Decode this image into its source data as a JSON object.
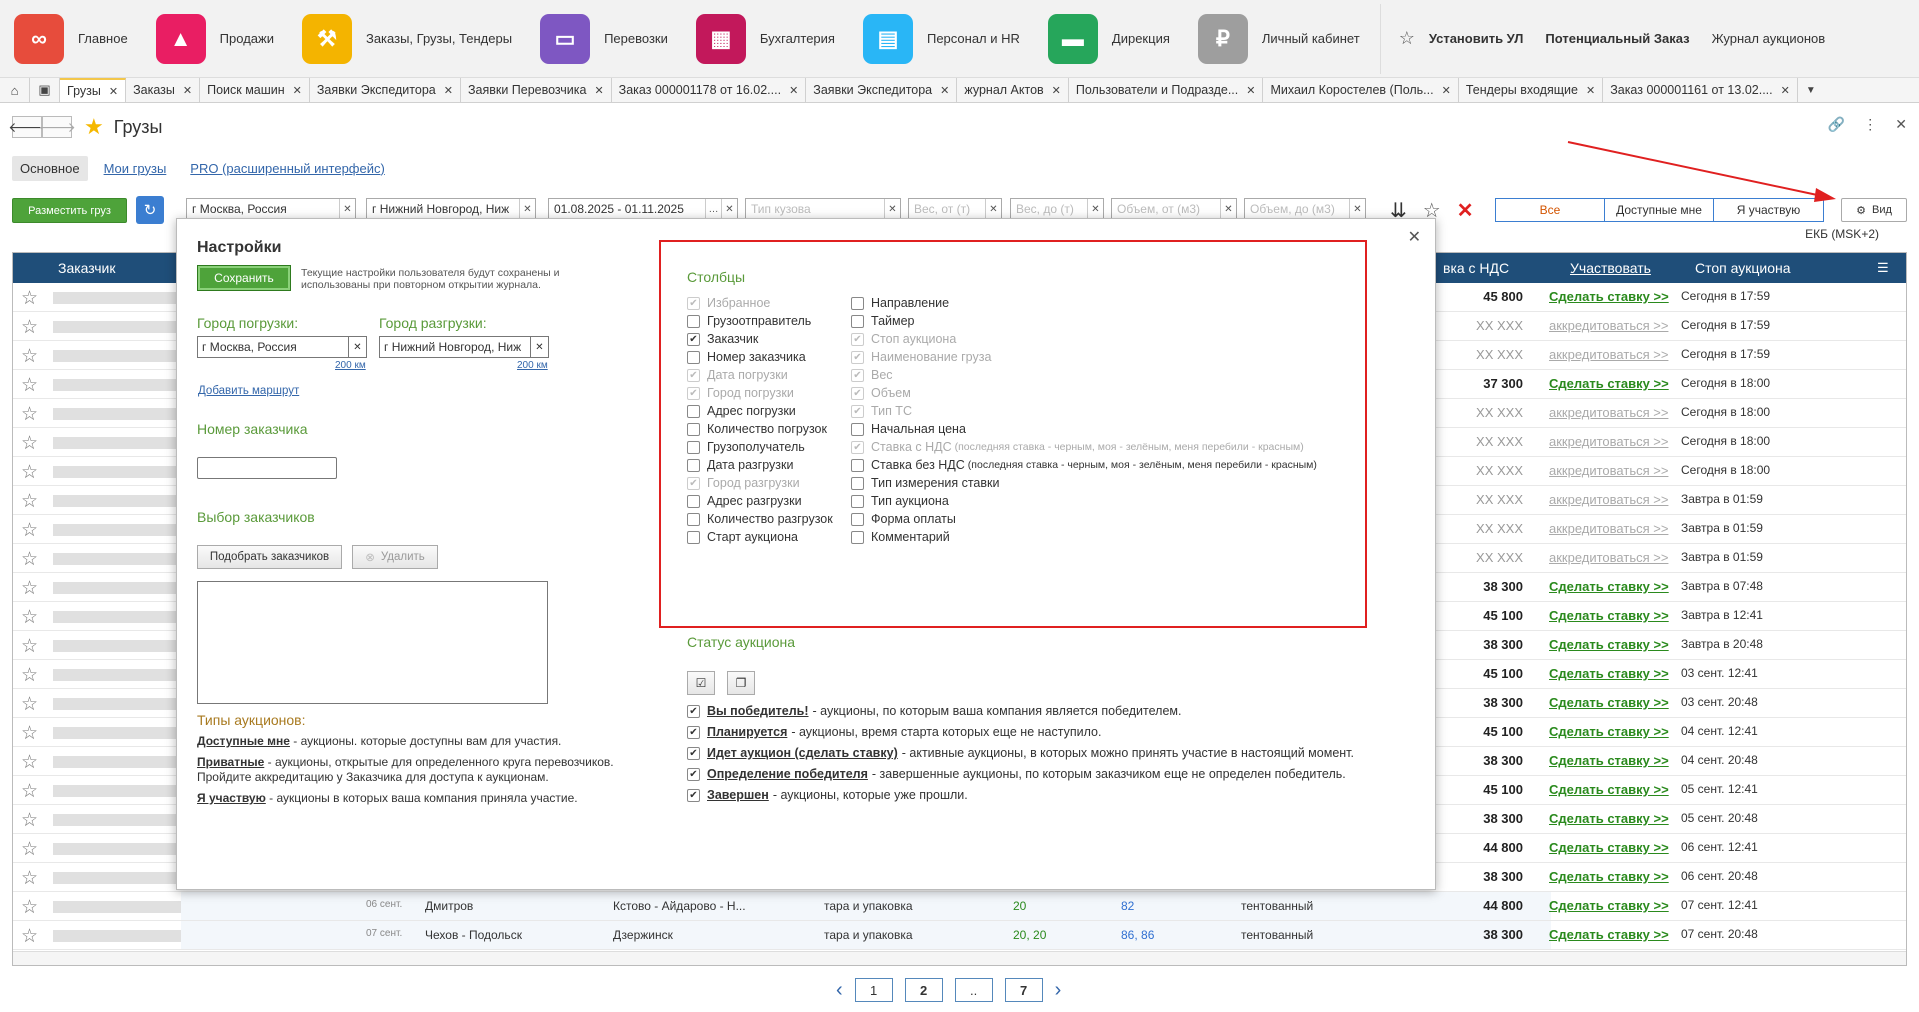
{
  "topnav": {
    "items": [
      {
        "label": "Главное",
        "icon": "logo-icon",
        "color": "#e74c3c"
      },
      {
        "label": "Продажи",
        "icon": "chart-up-icon",
        "color": "#e91e63"
      },
      {
        "label": "Заказы, Грузы, Тендеры",
        "icon": "gavel-icon",
        "color": "#f4b400"
      },
      {
        "label": "Перевозки",
        "icon": "truck-icon",
        "color": "#7e57c2"
      },
      {
        "label": "Бухгалтерия",
        "icon": "calculator-icon",
        "color": "#c2185b"
      },
      {
        "label": "Персонал и HR",
        "icon": "badge-icon",
        "color": "#29b6f6"
      },
      {
        "label": "Дирекция",
        "icon": "briefcase-icon",
        "color": "#26a65b"
      },
      {
        "label": "Личный кабинет",
        "icon": "lock-icon",
        "color": "#9e9e9e"
      }
    ],
    "links": [
      "Установить УЛ",
      "Потенциальный Заказ",
      "Журнал аукционов"
    ]
  },
  "tabs": [
    "Грузы",
    "Заказы",
    "Поиск машин",
    "Заявки Экспедитора",
    "Заявки Перевозчика",
    "Заказ 000001178 от 16.02....",
    "Заявки Экспедитора",
    "журнал Актов",
    "Пользователи и Подразде...",
    "Михаил Коростелев (Поль...",
    "Тендеры входящие",
    "Заказ 000001161 от 13.02...."
  ],
  "page": {
    "title": "Грузы",
    "subtabs": [
      "Основное",
      "Мои грузы",
      "PRO (расширенный интерфейс)"
    ]
  },
  "filters": {
    "place_button": "Разместить груз",
    "from": "г Москва, Россия",
    "to": "г Нижний Новгород, Ниж",
    "dates": "01.08.2025 - 01.11.2025",
    "body_type": "Тип кузова",
    "weight_from": "Вес, от (т)",
    "weight_to": "Вес, до (т)",
    "vol_from": "Объем, от (м3)",
    "vol_to": "Объем, до (м3)",
    "segments": [
      "Все",
      "Доступные мне",
      "Я участвую"
    ],
    "view_button": "Вид",
    "timezone": "ЕКБ (MSK+2)"
  },
  "grid": {
    "headers": {
      "customer": "Заказчик",
      "price": "вка с НДС",
      "participate": "Участвовать",
      "stop": "Стоп аукциона"
    },
    "rows": [
      {
        "price": "45 800",
        "action": "Сделать ставку >>",
        "stop": "Сегодня в 17:59",
        "kind": "bid"
      },
      {
        "price": "XX XXX",
        "action": "аккредитоваться >>",
        "stop": "Сегодня в 17:59",
        "kind": "acc"
      },
      {
        "price": "XX XXX",
        "action": "аккредитоваться >>",
        "stop": "Сегодня в 17:59",
        "kind": "acc"
      },
      {
        "price": "37 300",
        "action": "Сделать ставку >>",
        "stop": "Сегодня в 18:00",
        "kind": "bid"
      },
      {
        "price": "XX XXX",
        "action": "аккредитоваться >>",
        "stop": "Сегодня в 18:00",
        "kind": "acc"
      },
      {
        "price": "XX XXX",
        "action": "аккредитоваться >>",
        "stop": "Сегодня в 18:00",
        "kind": "acc"
      },
      {
        "price": "XX XXX",
        "action": "аккредитоваться >>",
        "stop": "Сегодня в 18:00",
        "kind": "acc"
      },
      {
        "price": "XX XXX",
        "action": "аккредитоваться >>",
        "stop": "Завтра в 01:59",
        "kind": "acc"
      },
      {
        "price": "XX XXX",
        "action": "аккредитоваться >>",
        "stop": "Завтра в 01:59",
        "kind": "acc"
      },
      {
        "price": "XX XXX",
        "action": "аккредитоваться >>",
        "stop": "Завтра в 01:59",
        "kind": "acc"
      },
      {
        "price": "38 300",
        "action": "Сделать ставку >>",
        "stop": "Завтра в 07:48",
        "kind": "bid"
      },
      {
        "price": "45 100",
        "action": "Сделать ставку >>",
        "stop": "Завтра в 12:41",
        "kind": "bid"
      },
      {
        "price": "38 300",
        "action": "Сделать ставку >>",
        "stop": "Завтра в 20:48",
        "kind": "bid"
      },
      {
        "price": "45 100",
        "action": "Сделать ставку >>",
        "stop": "03 сент. 12:41",
        "kind": "bid"
      },
      {
        "price": "38 300",
        "action": "Сделать ставку >>",
        "stop": "03 сент. 20:48",
        "kind": "bid"
      },
      {
        "price": "45 100",
        "action": "Сделать ставку >>",
        "stop": "04 сент. 12:41",
        "kind": "bid"
      },
      {
        "price": "38 300",
        "action": "Сделать ставку >>",
        "stop": "04 сент. 20:48",
        "kind": "bid"
      },
      {
        "price": "45 100",
        "action": "Сделать ставку >>",
        "stop": "05 сент. 12:41",
        "kind": "bid"
      },
      {
        "price": "38 300",
        "action": "Сделать ставку >>",
        "stop": "05 сент. 20:48",
        "kind": "bid"
      },
      {
        "price": "44 800",
        "action": "Сделать ставку >>",
        "stop": "06 сент. 12:41",
        "kind": "bid"
      },
      {
        "price": "38 300",
        "action": "Сделать ставку >>",
        "stop": "06 сент. 20:48",
        "kind": "bid"
      },
      {
        "price": "44 800",
        "action": "Сделать ставку >>",
        "stop": "07 сент. 12:41",
        "kind": "bid",
        "date": "06 сент.",
        "from": "Дмитров",
        "to": "Кстово - Айдарово - Н...",
        "cargo": "тара и упаковка",
        "weight": "20",
        "vol": "82",
        "body": "тентованный"
      },
      {
        "price": "38 300",
        "action": "Сделать ставку >>",
        "stop": "07 сент. 20:48",
        "kind": "bid",
        "date": "07 сент.",
        "from": "Чехов - Подольск",
        "to": "Дзержинск",
        "cargo": "тара и упаковка",
        "weight": "20, 20",
        "vol": "86, 86",
        "body": "тентованный"
      }
    ]
  },
  "pager": [
    "1",
    "2",
    "..",
    "7"
  ],
  "modal": {
    "title": "Настройки",
    "save": "Сохранить",
    "save_note": "Текущие настройки пользователя будут сохранены и использованы при повторном открытии журнала.",
    "city_load_label": "Город погрузки:",
    "city_unload_label": "Город разгрузки:",
    "city_load": "г Москва, Россия",
    "city_unload": "г Нижний Новгород, Ниж",
    "radius": "200 км",
    "add_route": "Добавить маршрут",
    "customer_no_label": "Номер заказчика",
    "customer_choice_label": "Выбор заказчиков",
    "pick_customers": "Подобрать заказчиков",
    "delete": "Удалить",
    "types": {
      "title": "Типы аукционов:",
      "items": [
        {
          "name": "Доступные мне",
          "desc": " - аукционы. которые доступны вам для участия."
        },
        {
          "name": "Приватные",
          "desc": " - аукционы, открытые для определенного круга перевозчиков. Пройдите аккредитацию у Заказчика для доступа к аукционам."
        },
        {
          "name": "Я участвую",
          "desc": " - аукционы в которых ваша компания приняла участие."
        }
      ]
    },
    "columns_title": "Столбцы",
    "columns_left": [
      {
        "label": "Избранное",
        "checked": true,
        "disabled": true
      },
      {
        "label": "Грузоотправитель",
        "checked": false,
        "disabled": false
      },
      {
        "label": "Заказчик",
        "checked": true,
        "disabled": false
      },
      {
        "label": "Номер заказчика",
        "checked": false,
        "disabled": false
      },
      {
        "label": "Дата погрузки",
        "checked": true,
        "disabled": true
      },
      {
        "label": "Город погрузки",
        "checked": true,
        "disabled": true
      },
      {
        "label": "Адрес погрузки",
        "checked": false,
        "disabled": false
      },
      {
        "label": "Количество погрузок",
        "checked": false,
        "disabled": false
      },
      {
        "label": "Грузополучатель",
        "checked": false,
        "disabled": false
      },
      {
        "label": "Дата разгрузки",
        "checked": false,
        "disabled": false
      },
      {
        "label": "Город разгрузки",
        "checked": true,
        "disabled": true
      },
      {
        "label": "Адрес разгрузки",
        "checked": false,
        "disabled": false
      },
      {
        "label": "Количество разгрузок",
        "checked": false,
        "disabled": false
      },
      {
        "label": "Старт аукциона",
        "checked": false,
        "disabled": false
      }
    ],
    "columns_right": [
      {
        "label": "Направление",
        "checked": false,
        "disabled": false
      },
      {
        "label": "Таймер",
        "checked": false,
        "disabled": false
      },
      {
        "label": "Стоп аукциона",
        "checked": true,
        "disabled": true
      },
      {
        "label": "Наименование груза",
        "checked": true,
        "disabled": true
      },
      {
        "label": "Вес",
        "checked": true,
        "disabled": true
      },
      {
        "label": "Объем",
        "checked": true,
        "disabled": true
      },
      {
        "label": "Тип ТС",
        "checked": true,
        "disabled": true
      },
      {
        "label": "Начальная цена",
        "checked": false,
        "disabled": false
      },
      {
        "label": "Ставка с НДС",
        "note": "(последняя ставка - черным,  моя - зелёным, меня перебили - красным)",
        "checked": true,
        "disabled": true
      },
      {
        "label": "Ставка без НДС",
        "note": "(последняя ставка - черным,  моя - зелёным, меня перебили - красным)",
        "checked": false,
        "disabled": false
      },
      {
        "label": "Тип измерения ставки",
        "checked": false,
        "disabled": false
      },
      {
        "label": "Тип аукциона",
        "checked": false,
        "disabled": false
      },
      {
        "label": "Форма оплаты",
        "checked": false,
        "disabled": false
      },
      {
        "label": "Комментарий",
        "checked": false,
        "disabled": false
      }
    ],
    "status_title": "Статус аукциона",
    "statuses": [
      {
        "name": "Вы победитель!",
        "desc": " - аукционы, по которым ваша компания является победителем."
      },
      {
        "name": "Планируется",
        "desc": " - аукционы, время старта которых еще не наступило."
      },
      {
        "name": "Идет аукцион (сделать ставку)",
        "desc": " - активные аукционы, в которых можно принять участие в настоящий момент."
      },
      {
        "name": "Определение победителя",
        "desc": " - завершенные аукционы, по которым заказчиком еще не определен победитель."
      },
      {
        "name": "Завершен",
        "desc": " - аукционы, которые уже прошли."
      }
    ]
  }
}
